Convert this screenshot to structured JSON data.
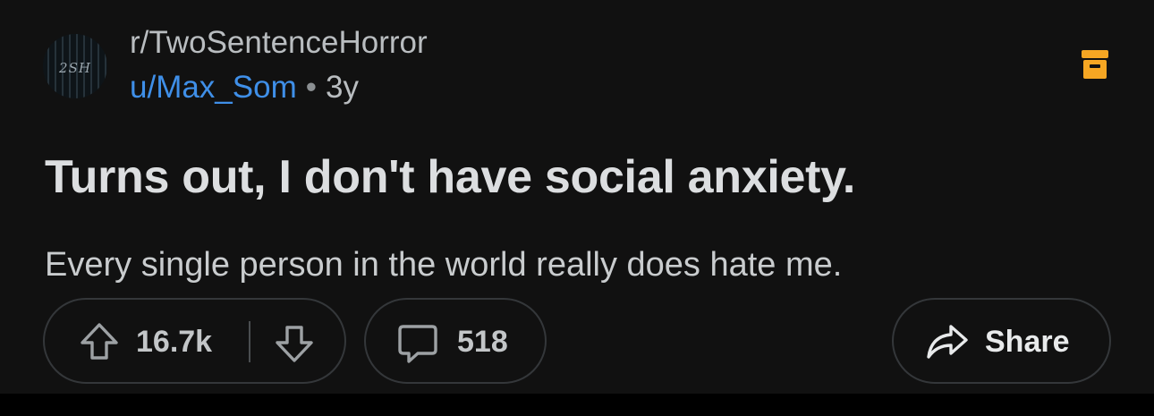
{
  "post": {
    "subreddit": "r/TwoSentenceHorror",
    "avatar_text": "2SH",
    "author": "u/Max_Som",
    "separator": "•",
    "age": "3y",
    "title": "Turns out, I don't have social anxiety.",
    "body": "Every single person in the world really does hate me."
  },
  "actions": {
    "upvote_icon": "arrow-up-icon",
    "score": "16.7k",
    "downvote_icon": "arrow-down-icon",
    "comment_icon": "speech-bubble-icon",
    "comment_count": "518",
    "share_icon": "share-arrow-icon",
    "share_label": "Share"
  },
  "header": {
    "archive_icon": "archive-box-icon",
    "archive_color": "#f5a623"
  },
  "colors": {
    "background": "#111111",
    "author_link": "#3f8fe8",
    "title": "#dcdee0",
    "pill_border": "#34373a"
  }
}
